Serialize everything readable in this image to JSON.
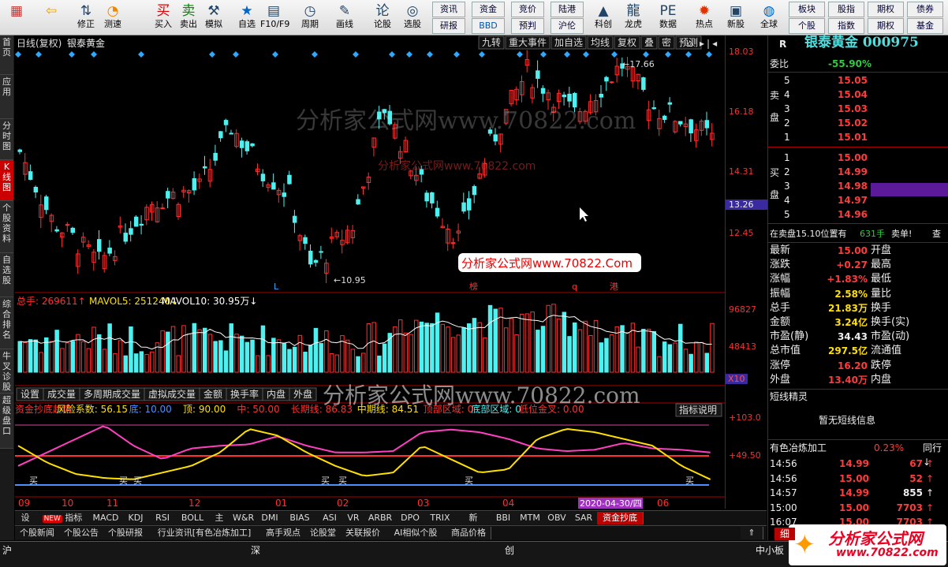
{
  "toolbar": {
    "icons": [
      {
        "name": "home-grid-icon",
        "label": ""
      },
      {
        "name": "back-arrow-icon",
        "label": ""
      },
      {
        "name": "arrows-updown-icon",
        "label": "修正"
      },
      {
        "name": "speed-gauge-icon",
        "label": "测速"
      },
      {
        "name": "buy-icon",
        "label": "买入"
      },
      {
        "name": "sell-icon",
        "label": "卖出"
      },
      {
        "name": "hammer-icon",
        "label": "模拟"
      },
      {
        "name": "star-icon",
        "label": "自选"
      },
      {
        "name": "window-icon",
        "label": "F10/F9"
      },
      {
        "name": "clock-icon",
        "label": "周期"
      },
      {
        "name": "pencil-icon",
        "label": "画线"
      },
      {
        "name": "lun-icon",
        "label": "论股"
      },
      {
        "name": "select-stock-icon",
        "label": "选股"
      },
      {
        "name": "kechuang-icon",
        "label": "科创"
      },
      {
        "name": "dragon-icon",
        "label": "龙虎"
      },
      {
        "name": "pe-icon",
        "label": "数据"
      },
      {
        "name": "hot-icon",
        "label": "热点"
      },
      {
        "name": "new-stock-icon",
        "label": "新股"
      },
      {
        "name": "globe-icon",
        "label": "全球"
      }
    ],
    "small_buttons": [
      [
        "资讯",
        "资金",
        "竞价",
        "陆港"
      ],
      [
        "研报",
        "BBD",
        "预判",
        "沪伦"
      ]
    ],
    "right_buttons": [
      [
        "板块",
        "股指",
        "期权",
        "债券"
      ],
      [
        "个股",
        "指数",
        "期权",
        "基金"
      ]
    ]
  },
  "lefttabs": [
    "首页",
    "应用",
    "分时图",
    "K线图",
    "个股资料",
    "自选股",
    "综合排名",
    "牛叉诊股",
    "超级盘口"
  ],
  "chart": {
    "title_left": "日线(复权)",
    "stock_name": "银泰黄金",
    "top_buttons": [
      "九转",
      "重大事件",
      "加自选",
      "均线",
      "复权",
      "叠",
      "密",
      "预测"
    ],
    "price_axis": [
      "18.03",
      "16.18",
      "14.31",
      "12.45"
    ],
    "current_price_tag": "13.26",
    "high_label": "17.66",
    "low_label": "10.95",
    "event_labels": [
      "L",
      "榜",
      "q",
      "港"
    ],
    "vol_header": {
      "a": "总手: 269611",
      "b": "MAVOL5: 251240",
      "c": "MAVOL10: 30.95万"
    },
    "vol_axis": [
      "96827",
      "48413",
      "X10"
    ],
    "vol_tabs": [
      "设置",
      "成交量",
      "多周期成交量",
      "虚拟成交量",
      "金额",
      "换手率",
      "内盘",
      "外盘"
    ],
    "ind_header": {
      "name": "资金抄底趋势",
      "r": "风险系数: 56.15",
      "d": "底: 10.00",
      "t": "顶: 90.00",
      "m": "中: 50.00",
      "l": "长期线: 86.83",
      "mid": "中期线: 84.51",
      "top": "顶部区域: 0",
      "bot": "底部区域: 0",
      "gold": "低位金叉: 0.00"
    },
    "ind_button": "指标说明",
    "ind_axis": [
      "+103.0",
      "+49.50"
    ],
    "buy_labels": [
      "买",
      "买",
      "买",
      "买",
      "买",
      "买"
    ],
    "months": [
      "09",
      "10",
      "11",
      "12",
      "01",
      "02",
      "03",
      "04",
      "05",
      "06"
    ],
    "date_tag": "2020-04-30/四",
    "ind_tabs": [
      "设置",
      "指标平台",
      "MACD",
      "KDJ",
      "RSI",
      "BOLL",
      "主力",
      "W&R",
      "DMI",
      "BIAS",
      "ASI",
      "VR",
      "ARBR",
      "DPO",
      "TRIX",
      "新DMA",
      "BBI",
      "MTM",
      "OBV",
      "SAR",
      "资金抄底趋势"
    ],
    "news_tabs": [
      "个股新闻",
      "个股公告",
      "个股研报",
      "行业资讯[有色冶炼加工]",
      "高手观点",
      "论股堂",
      "关联报价",
      "AI相似个股",
      "商品价格"
    ],
    "watermark1": "分析家公式网www.70822.com",
    "watermark2": "分析家公式网www.70822.com",
    "watermark3": "分析家公式网www.70822.Com",
    "watermark4": "分析家公式网www.70822.com"
  },
  "chart_data": {
    "type": "candlestick",
    "title": "银泰黄金",
    "high": 17.66,
    "low": 10.95,
    "ylim": [
      10.5,
      18.03
    ],
    "volume_ylim": [
      0,
      96827
    ],
    "indicator_ylim": [
      0,
      103.0
    ]
  },
  "right": {
    "code_prefix": "R",
    "title": "银泰黄金 000975",
    "weibi_label": "委比",
    "weibi_value": "-55.90%",
    "sell_label": "卖盘",
    "buy_label": "买盘",
    "sells": [
      {
        "n": "5",
        "p": "15.05"
      },
      {
        "n": "4",
        "p": "15.04"
      },
      {
        "n": "3",
        "p": "15.03"
      },
      {
        "n": "2",
        "p": "15.02"
      },
      {
        "n": "1",
        "p": "15.01"
      }
    ],
    "buys": [
      {
        "n": "1",
        "p": "15.00"
      },
      {
        "n": "2",
        "p": "14.99"
      },
      {
        "n": "3",
        "p": "14.98"
      },
      {
        "n": "4",
        "p": "14.97"
      },
      {
        "n": "5",
        "p": "14.96"
      }
    ],
    "zaimai": "在卖盘15.10位置有",
    "zaimai_qty": "631手",
    "zaimai_tag": "卖单!",
    "zaimai_more": "查",
    "stats": [
      {
        "k": "最新",
        "v": "15.00",
        "c": "red",
        "k2": "开盘"
      },
      {
        "k": "涨跌",
        "v": "+0.27",
        "c": "red",
        "k2": "最高"
      },
      {
        "k": "涨幅",
        "v": "+1.83%",
        "c": "red",
        "k2": "最低"
      },
      {
        "k": "振幅",
        "v": "2.58%",
        "c": "yellow",
        "k2": "量比"
      },
      {
        "k": "总手",
        "v": "21.83万",
        "c": "yellow",
        "k2": "换手"
      },
      {
        "k": "金额",
        "v": "3.24亿",
        "c": "yellow",
        "k2": "换手(实)"
      },
      {
        "k": "市盈(静)",
        "v": "34.43",
        "c": "white",
        "k2": "市盈(动)"
      },
      {
        "k": "总市值",
        "v": "297.5亿",
        "c": "yellow",
        "k2": "流通值"
      },
      {
        "k": "涨停",
        "v": "16.20",
        "c": "red",
        "k2": "跌停"
      },
      {
        "k": "外盘",
        "v": "13.40万",
        "c": "red",
        "k2": "内盘"
      }
    ],
    "short_title": "短线精灵",
    "short_msg": "暂无短线信息",
    "industry": "有色冶炼加工",
    "industry_pct": "0.23%",
    "industry_more": "同行↓",
    "ticks": [
      {
        "t": "14:56",
        "p": "14.99",
        "v": "67",
        "c": "red"
      },
      {
        "t": "14:56",
        "p": "15.00",
        "v": "52",
        "c": "red"
      },
      {
        "t": "14:57",
        "p": "14.99",
        "v": "855",
        "c": "white"
      },
      {
        "t": "15:00",
        "p": "15.00",
        "v": "7703",
        "c": "red"
      },
      {
        "t": "16:07",
        "p": "15.00",
        "v": "7703",
        "c": "red"
      }
    ],
    "xi": "细"
  },
  "status": {
    "hu": "沪",
    "shen": "深",
    "chuang": "创",
    "zhongxiao": "中小板",
    "logo": "分析家公式网",
    "logo_url": "www.70822.com"
  }
}
